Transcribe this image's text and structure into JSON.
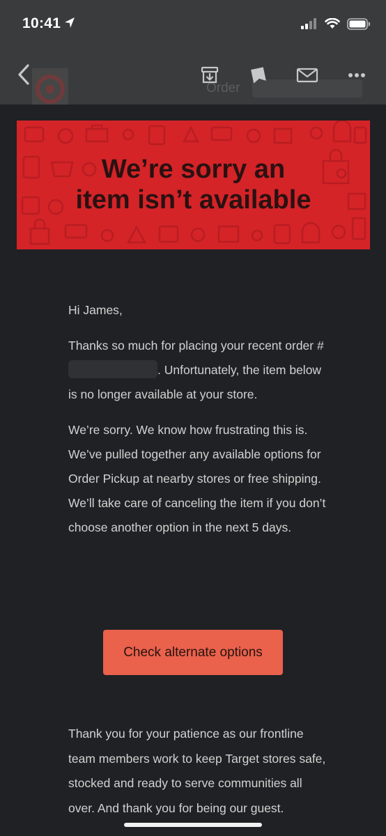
{
  "status_bar": {
    "time": "10:41",
    "icons": [
      "location-arrow-icon",
      "cellular-signal-icon",
      "wifi-icon",
      "battery-icon"
    ]
  },
  "toolbar": {
    "actions": [
      "back-icon",
      "archive-icon",
      "label-icon",
      "mail-icon",
      "more-icon"
    ],
    "ghost_subject": "Order"
  },
  "email": {
    "banner_title_line1": "We’re sorry an",
    "banner_title_line2": "item isn’t available",
    "greeting": "Hi James,",
    "para1_part1": "Thanks so much for placing your recent order #",
    "para1_part2": ". Unfortunately, the item below is no longer available at your store.",
    "para2": "We’re sorry. We know how frustrating this is. We’ve pulled together any available options for Order Pickup at nearby stores or free shipping. We’ll take care of canceling the item if you don’t choose another option in the next 5 days.",
    "cta_label": "Check alternate options",
    "para3": "Thank you for your patience as our frontline team members work to keep Target stores safe, stocked and ready to serve communities all over. And thank you for being our guest."
  },
  "colors": {
    "banner_red": "#d42428",
    "cta_coral": "#ea614c",
    "background": "#202124",
    "toolbar": "#3a3b3d"
  }
}
